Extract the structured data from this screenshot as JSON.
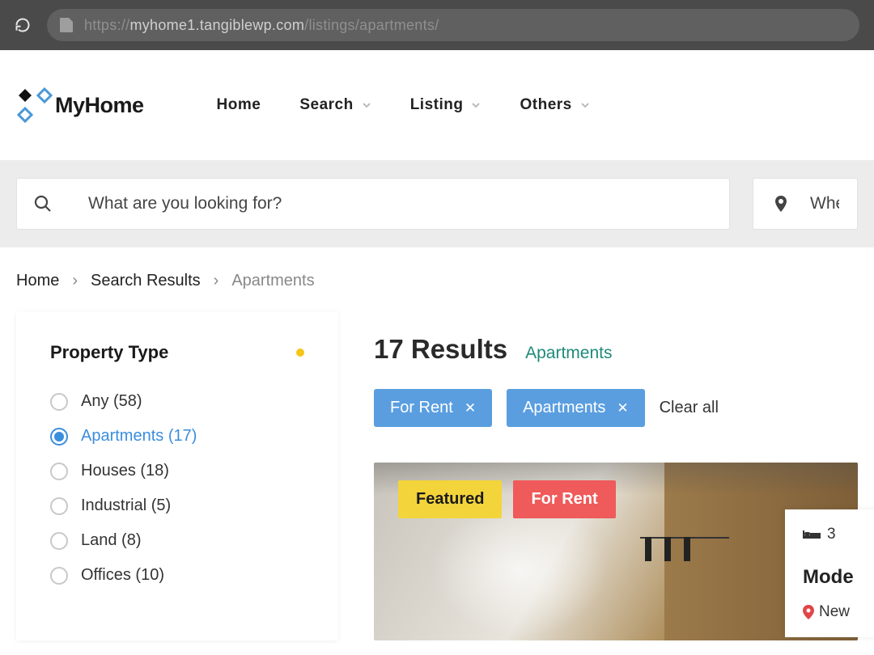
{
  "browser": {
    "url_proto": "https://",
    "url_host": "myhome1.tangiblewp.com",
    "url_path": "/listings/apartments/"
  },
  "logo": {
    "text1": "My",
    "text2": "Home"
  },
  "nav": {
    "home": "Home",
    "search": "Search",
    "listing": "Listing",
    "others": "Others"
  },
  "search": {
    "placeholder_main": "What are you looking for?",
    "placeholder_loc": "Where"
  },
  "crumbs": {
    "home": "Home",
    "results": "Search Results",
    "current": "Apartments"
  },
  "sidebar": {
    "title": "Property Type",
    "items": [
      {
        "label": "Any (58)"
      },
      {
        "label": "Apartments (17)"
      },
      {
        "label": "Houses (18)"
      },
      {
        "label": "Industrial (5)"
      },
      {
        "label": "Land (8)"
      },
      {
        "label": "Offices (10)"
      }
    ]
  },
  "results": {
    "count_label": "17 Results",
    "tag": "Apartments",
    "chips": [
      {
        "label": "For Rent"
      },
      {
        "label": "Apartments"
      }
    ],
    "clear": "Clear all"
  },
  "card": {
    "badges": {
      "featured": "Featured",
      "rent": "For Rent"
    }
  },
  "right_card": {
    "beds": "3",
    "title": "Mode",
    "loc": "New"
  }
}
